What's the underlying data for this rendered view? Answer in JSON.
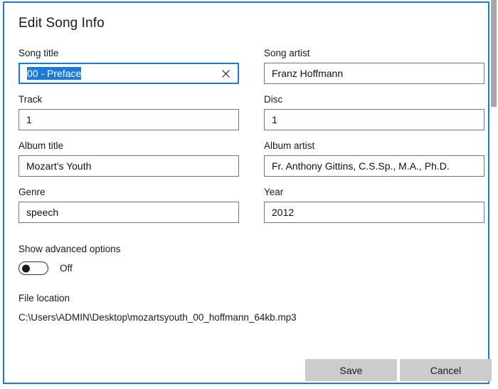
{
  "dialog": {
    "title": "Edit Song Info"
  },
  "fields": {
    "song_title": {
      "label": "Song title",
      "value": "00 - Preface",
      "selected": true,
      "focused": true,
      "clear_icon": "close-icon"
    },
    "song_artist": {
      "label": "Song artist",
      "value": "Franz  Hoffmann"
    },
    "track": {
      "label": "Track",
      "value": "1"
    },
    "disc": {
      "label": "Disc",
      "value": "1"
    },
    "album_title": {
      "label": "Album title",
      "value": "Mozart's Youth"
    },
    "album_artist": {
      "label": "Album artist",
      "value": "Fr. Anthony Gittins, C.S.Sp., M.A., Ph.D."
    },
    "genre": {
      "label": "Genre",
      "value": "speech"
    },
    "year": {
      "label": "Year",
      "value": "2012"
    }
  },
  "advanced": {
    "label": "Show advanced options",
    "state": "Off"
  },
  "file_location": {
    "label": "File location",
    "path": "C:\\Users\\ADMIN\\Desktop\\mozartsyouth_00_hoffmann_64kb.mp3"
  },
  "footer": {
    "save_label": "Save",
    "cancel_label": "Cancel"
  },
  "colors": {
    "accent": "#1b7ad4",
    "selection": "#1b7ad4",
    "button_face": "#cccccc",
    "field_border": "#757575",
    "text": "#1a1a1a"
  }
}
